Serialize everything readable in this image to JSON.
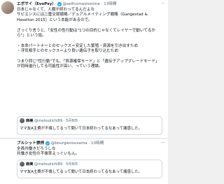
{
  "post1": {
    "name": "エボサイ（EvoPsy）",
    "handle": "@selfcomestomine",
    "time": "13時間",
    "body": "日本じゃなくて、人類が終わってるんだよな\nサピエンスには二重交尾戦略／デュアルメイティング戦略（Gangestad & Haselton 2015）という本能があるので。\n\nざっくり言うと、「女性の性行動は\"1つの目的じゃなくてレイヤーで動いてるから\"」という話。\n\n・本命パートナーとのセックス＝安定した繁殖・資源を引き出すため\n・浮気相手とのセックス＝より良い遺伝子を取り込むため\n\nつまり同じ\"性行動\"でも、「資源確保モード」と「遺伝子アップグレードモード」が同時進行してる可能性が高い、っていう理論。",
    "quote": {
      "name": "麻美",
      "handle": "@matsukichi89",
      "date": "5月8日",
      "text": "ママ友A主費が不倫してるって聞いて日本終わってるなあって痛感した。"
    }
  },
  "post2": {
    "name": "ブルシット崇拝",
    "handle": "@bourgeoisusama",
    "time": "10時間",
    "body": "全員共働きだろうしな\n共働き女性の不倫率えっぐいもん。",
    "quote": {
      "name": "麻美",
      "handle": "@matsukichi89",
      "date": "5月8日",
      "text": "ママ友A主費が不倫してるって聞いて日本終わってるなあって痛感した。"
    }
  },
  "icons": {
    "verified": "verified-badge-icon",
    "menu": "more-options-icon"
  },
  "colors": {
    "verified": "#1d9bf0",
    "text": "#0f1419",
    "muted": "#536471",
    "border": "#cfd9de"
  },
  "menu_glyph": "···"
}
